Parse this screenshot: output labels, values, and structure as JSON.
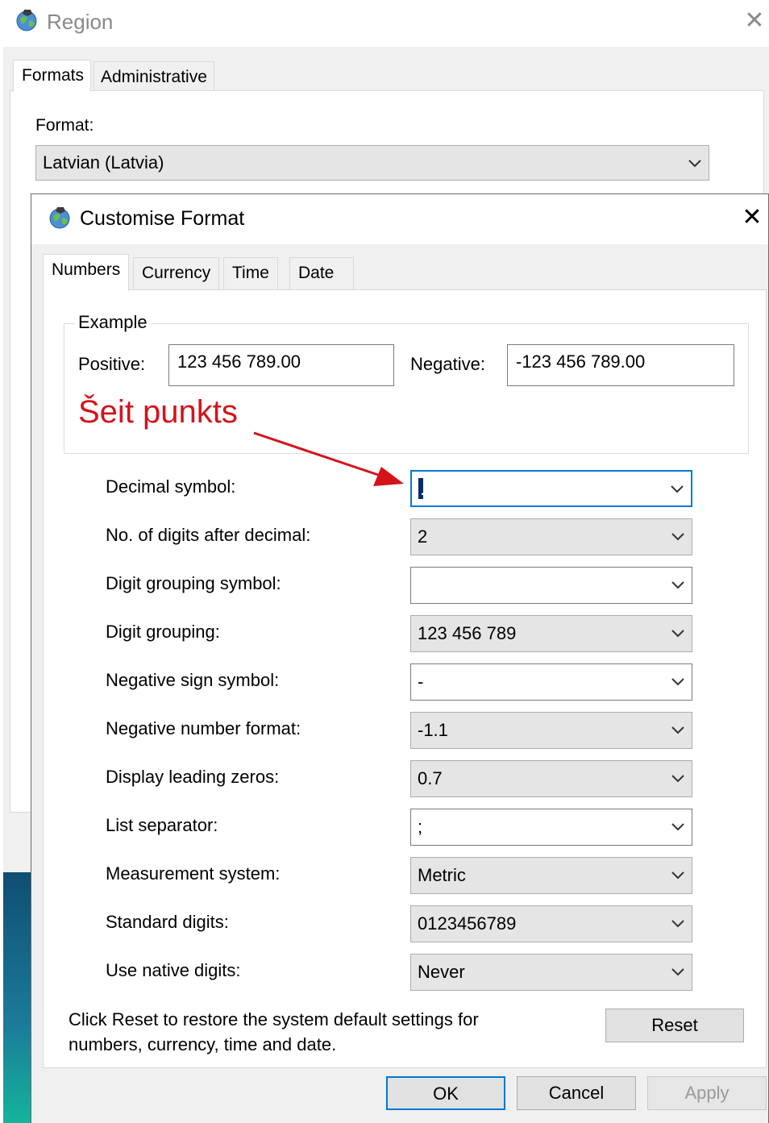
{
  "region": {
    "title": "Region",
    "close_glyph": "✕",
    "tabs": [
      {
        "label": "Formats",
        "selected": true
      },
      {
        "label": "Administrative",
        "selected": false
      }
    ],
    "format_label": "Format:",
    "format_value": "Latvian (Latvia)"
  },
  "dialog": {
    "title": "Customise Format",
    "close_glyph": "✕",
    "tabs": [
      {
        "label": "Numbers",
        "selected": true
      },
      {
        "label": "Currency",
        "selected": false
      },
      {
        "label": "Time",
        "selected": false
      },
      {
        "label": "Date",
        "selected": false
      }
    ],
    "example": {
      "legend": "Example",
      "positive_label": "Positive:",
      "positive_value": "123 456 789.00",
      "negative_label": "Negative:",
      "negative_value": "-123 456 789.00"
    },
    "annotation": {
      "text": "Šeit punkts",
      "color": "#d4131b"
    },
    "settings": [
      {
        "label": "Decimal symbol:",
        "value": ".",
        "editable": true,
        "focused": true
      },
      {
        "label": "No. of digits after decimal:",
        "value": "2",
        "editable": false
      },
      {
        "label": "Digit grouping symbol:",
        "value": "",
        "editable": true
      },
      {
        "label": "Digit grouping:",
        "value": "123 456 789",
        "editable": false
      },
      {
        "label": "Negative sign symbol:",
        "value": "-",
        "editable": true
      },
      {
        "label": "Negative number format:",
        "value": "-1.1",
        "editable": false
      },
      {
        "label": "Display leading zeros:",
        "value": "0.7",
        "editable": false
      },
      {
        "label": "List separator:",
        "value": ";",
        "editable": true
      },
      {
        "label": "Measurement system:",
        "value": "Metric",
        "editable": false
      },
      {
        "label": "Standard digits:",
        "value": "0123456789",
        "editable": false
      },
      {
        "label": "Use native digits:",
        "value": "Never",
        "editable": false
      }
    ],
    "reset_help_text": "Click Reset to restore the system default settings for numbers, currency, time and date.",
    "buttons": {
      "reset": "Reset",
      "ok": "OK",
      "cancel": "Cancel",
      "apply": "Apply"
    }
  },
  "colors": {
    "focus_accent": "#0078d7",
    "dialog_background": "#f0f0f0"
  }
}
